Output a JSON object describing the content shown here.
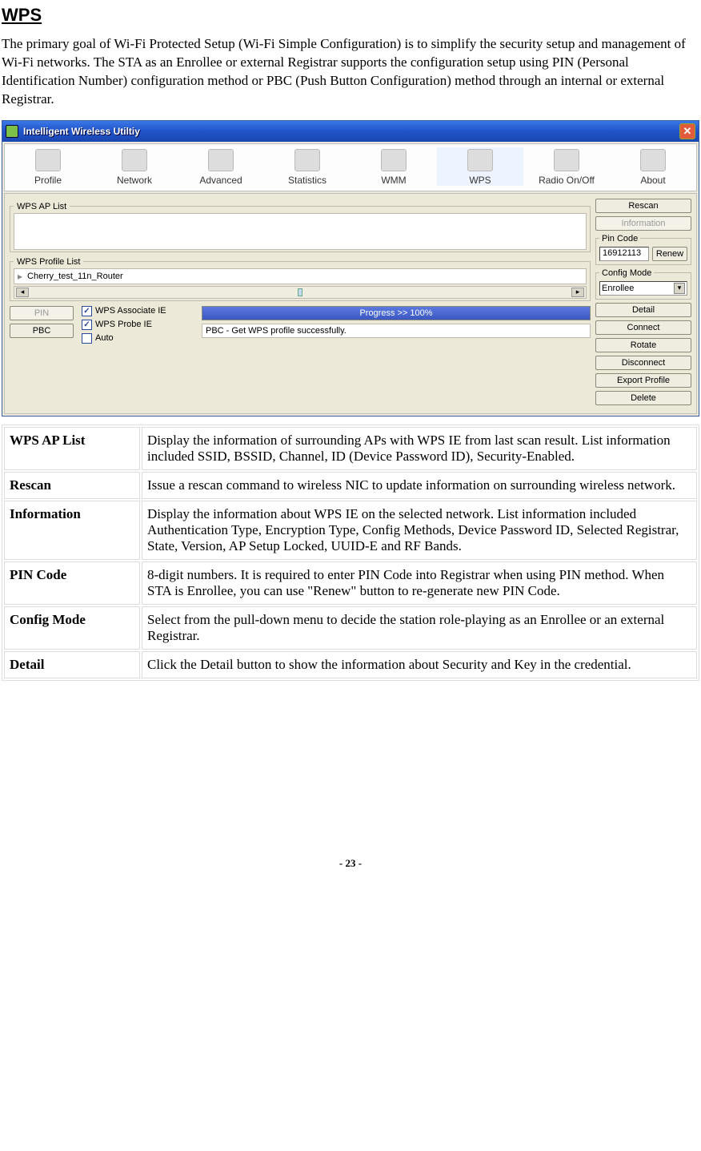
{
  "heading": "WPS",
  "intro": "The primary goal of Wi-Fi Protected Setup (Wi-Fi Simple Configuration) is to simplify the security setup and management of Wi-Fi networks. The STA as an Enrollee or external Registrar supports the configuration setup using PIN (Personal Identification Number) configuration method or PBC (Push Button Configuration) method through an internal or external Registrar.",
  "window": {
    "title": "Intelligent Wireless Utiltiy",
    "tabs": [
      "Profile",
      "Network",
      "Advanced",
      "Statistics",
      "WMM",
      "WPS",
      "Radio On/Off",
      "About"
    ],
    "selected_tab_index": 5,
    "ap_list_legend": "WPS AP List",
    "profile_list_legend": "WPS Profile List",
    "profile_item": "Cherry_test_11n_Router",
    "buttons": {
      "rescan": "Rescan",
      "information": "Information",
      "renew": "Renew",
      "detail": "Detail",
      "connect": "Connect",
      "rotate": "Rotate",
      "disconnect": "Disconnect",
      "export_profile": "Export Profile",
      "delete": "Delete",
      "pin": "PIN",
      "pbc": "PBC"
    },
    "pincode_legend": "Pin Code",
    "pincode_value": "16912113",
    "configmode_legend": "Config Mode",
    "configmode_value": "Enrollee",
    "checks": {
      "assoc": "WPS Associate IE",
      "probe": "WPS Probe IE",
      "auto": "Auto"
    },
    "progress_label": "Progress >> 100%",
    "status_msg": "PBC - Get WPS profile successfully."
  },
  "table": [
    {
      "k": "WPS AP List",
      "v": "Display the information of surrounding APs with WPS IE from last scan result. List information included SSID, BSSID, Channel, ID (Device Password ID), Security-Enabled."
    },
    {
      "k": "Rescan",
      "v": "Issue a rescan command to wireless NIC to update information on surrounding wireless network."
    },
    {
      "k": "Information",
      "v": "Display the information about WPS IE on the selected network. List information included Authentication Type, Encryption Type, Config Methods, Device Password ID, Selected Registrar, State, Version, AP Setup Locked, UUID-E and RF Bands."
    },
    {
      "k": "PIN Code",
      "v": "8-digit numbers. It is required to enter PIN Code into Registrar when using PIN method. When STA is Enrollee, you can use \"Renew\" button to re-generate new PIN Code."
    },
    {
      "k": "Config Mode",
      "v": "Select from the pull-down menu to decide the station role-playing as an Enrollee or an external Registrar."
    },
    {
      "k": "Detail",
      "v": "Click the Detail button to show the information about Security and Key in the credential."
    }
  ],
  "footer": "- 23 -"
}
